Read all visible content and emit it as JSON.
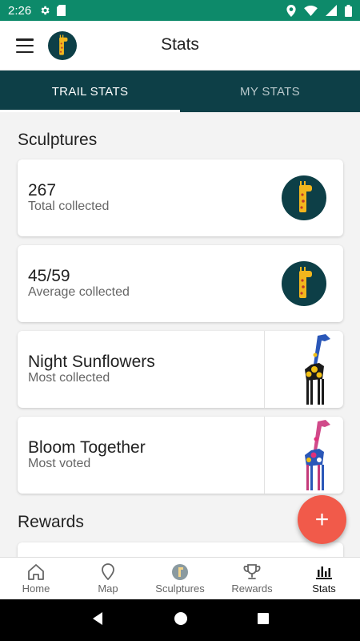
{
  "status_bar": {
    "time": "2:26"
  },
  "app_bar": {
    "title": "Stats"
  },
  "tabs": [
    {
      "label": "TRAIL STATS",
      "active": true
    },
    {
      "label": "MY STATS",
      "active": false
    }
  ],
  "sculptures_section": {
    "title": "Sculptures",
    "cards": [
      {
        "value": "267",
        "label": "Total collected",
        "image": "giraffe-logo-icon"
      },
      {
        "value": "45/59",
        "label": "Average collected",
        "image": "giraffe-logo-icon"
      },
      {
        "value": "Night Sunflowers",
        "label": "Most collected",
        "image": "sunflower-giraffe-sculpture"
      },
      {
        "value": "Bloom Together",
        "label": "Most voted",
        "image": "floral-giraffe-sculpture"
      }
    ]
  },
  "rewards_section": {
    "title": "Rewards"
  },
  "fab": {
    "icon": "plus-icon",
    "label": "+"
  },
  "bottom_nav": [
    {
      "label": "Home",
      "icon": "home-icon",
      "active": false
    },
    {
      "label": "Map",
      "icon": "map-pin-icon",
      "active": false
    },
    {
      "label": "Sculptures",
      "icon": "giraffe-icon",
      "active": false
    },
    {
      "label": "Rewards",
      "icon": "trophy-icon",
      "active": false
    },
    {
      "label": "Stats",
      "icon": "bar-chart-icon",
      "active": true
    }
  ],
  "colors": {
    "status_bar": "#0d8a6a",
    "tab_bar": "#0d3f47",
    "fab": "#f15a4a",
    "logo_bg": "#0d3f47",
    "giraffe": "#f2b61d"
  }
}
